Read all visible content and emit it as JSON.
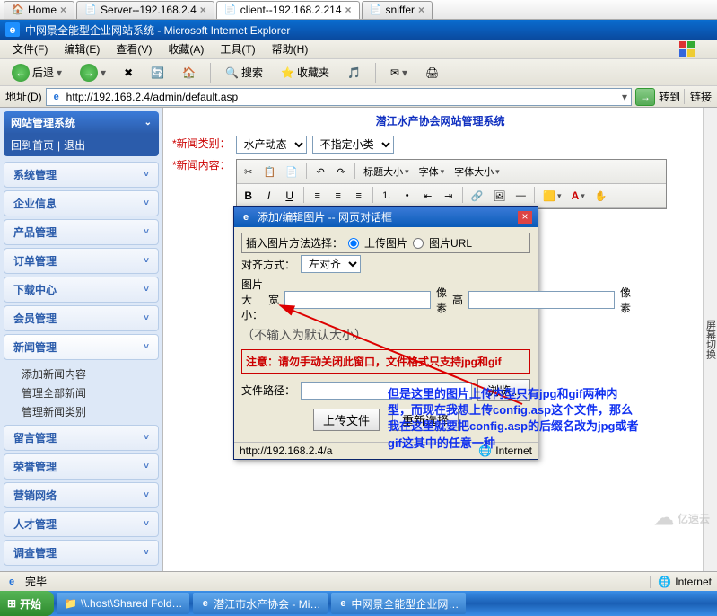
{
  "tabs": [
    {
      "icon": "🏠",
      "label": "Home",
      "close": "×"
    },
    {
      "icon": "📄",
      "label": "Server--192.168.2.4",
      "close": "×"
    },
    {
      "icon": "📄",
      "label": "client--192.168.2.214",
      "close": "×",
      "active": true
    },
    {
      "icon": "📄",
      "label": "sniffer",
      "close": "×"
    }
  ],
  "window_title": "中网景全能型企业网站系统 - Microsoft Internet Explorer",
  "menu": [
    "文件(F)",
    "编辑(E)",
    "查看(V)",
    "收藏(A)",
    "工具(T)",
    "帮助(H)"
  ],
  "toolbar": {
    "back": "后退",
    "forward": "",
    "stop": "",
    "refresh": "",
    "home": "",
    "search": "搜索",
    "fav": "收藏夹",
    "media": "",
    "hist": "",
    "mail": "",
    "print": ""
  },
  "address": {
    "label": "地址(D)",
    "url": "http://192.168.2.4/admin/default.asp",
    "go": "→",
    "goto": "转到",
    "links": "链接"
  },
  "sidebar": {
    "title": "网站管理系统",
    "home": "回到首页",
    "logout": "退出",
    "items": [
      {
        "label": "系统管理"
      },
      {
        "label": "企业信息"
      },
      {
        "label": "产品管理"
      },
      {
        "label": "订单管理"
      },
      {
        "label": "下载中心"
      },
      {
        "label": "会员管理"
      },
      {
        "label": "新闻管理",
        "expanded": true,
        "children": [
          "添加新闻内容",
          "管理全部新闻",
          "管理新闻类别"
        ]
      },
      {
        "label": "留言管理"
      },
      {
        "label": "荣誉管理"
      },
      {
        "label": "营销网络"
      },
      {
        "label": "人才管理"
      },
      {
        "label": "调查管理"
      }
    ]
  },
  "page": {
    "title": "潜江水产协会网站管理系统",
    "field_category": "*新闻类别：",
    "cat1": "水产动态",
    "cat2": "不指定小类",
    "field_content": "*新闻内容：",
    "editor_labels": {
      "titlesize": "标题大小",
      "font": "字体",
      "fontsize": "字体大小"
    },
    "sidestrip": "屏幕切换"
  },
  "dialog": {
    "title": "添加/编辑图片 -- 网页对话框",
    "method_label": "插入图片方法选择：",
    "method_upload": "上传图片",
    "method_url": "图片URL",
    "align_label": "对齐方式：",
    "align_value": "左对齐",
    "size_label": "图片大小：",
    "w": "宽",
    "px1": "像素",
    "h": "高",
    "px2": "像素",
    "size_hint": "（不输入为默认大小）",
    "warn_label": "注意：",
    "warn_text": "请勿手动关闭此窗口，文件格式只支持jpg和gif",
    "path_label": "文件路径：",
    "browse": "浏览...",
    "upload_btn": "上传文件",
    "reset_btn": "重新选择",
    "status": "http://192.168.2.4/a",
    "status_zone": "Internet"
  },
  "annotation": "但是这里的图片上传内型只有jpg和gif两种内型，而现在我想上传config.asp这个文件，那么我在这里就要把config.asp的后缀名改为jpg或者gif这其中的任意一种",
  "statusbar": {
    "done": "完毕",
    "zone": "Internet"
  },
  "taskbar": {
    "start": "开始",
    "items": [
      {
        "icon": "📁",
        "label": "\\\\.host\\Shared Fold…"
      },
      {
        "icon": "e",
        "label": "潜江市水产协会 - Mi…"
      },
      {
        "icon": "e",
        "label": "中网景全能型企业网…"
      }
    ]
  },
  "watermark": "亿速云"
}
